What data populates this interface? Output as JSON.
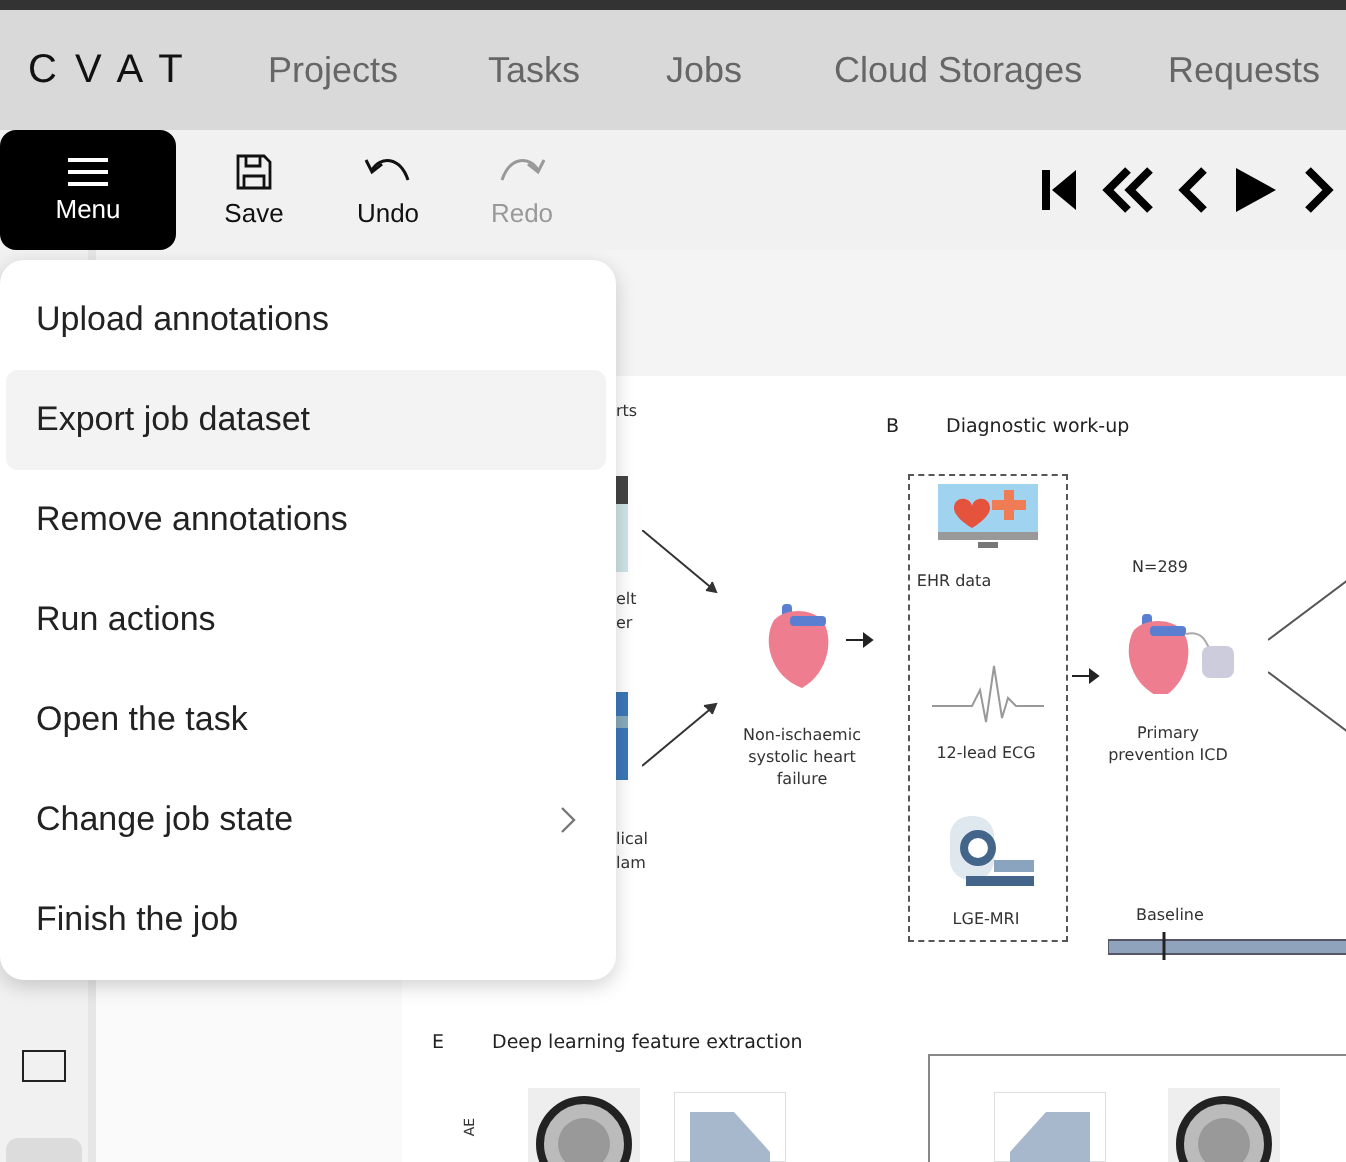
{
  "header": {
    "logo": "CVAT",
    "nav": [
      {
        "label": "Projects"
      },
      {
        "label": "Tasks"
      },
      {
        "label": "Jobs"
      },
      {
        "label": "Cloud Storages"
      },
      {
        "label": "Requests"
      }
    ]
  },
  "toolbar": {
    "menu_button": "Menu",
    "actions": [
      {
        "kind": "save",
        "label": "Save",
        "disabled": false
      },
      {
        "kind": "undo",
        "label": "Undo",
        "disabled": false
      },
      {
        "kind": "redo",
        "label": "Redo",
        "disabled": true
      }
    ],
    "player": [
      {
        "kind": "first"
      },
      {
        "kind": "fast-back"
      },
      {
        "kind": "back"
      },
      {
        "kind": "play"
      },
      {
        "kind": "forward"
      }
    ]
  },
  "menu": {
    "items": [
      {
        "label": "Upload annotations",
        "selected": false,
        "submenu": false
      },
      {
        "label": "Export job dataset",
        "selected": true,
        "submenu": false
      },
      {
        "label": "Remove annotations",
        "selected": false,
        "submenu": false
      },
      {
        "label": "Run actions",
        "selected": false,
        "submenu": false
      },
      {
        "label": "Open the task",
        "selected": false,
        "submenu": false
      },
      {
        "label": "Change job state",
        "selected": false,
        "submenu": true
      },
      {
        "label": "Finish the job",
        "selected": false,
        "submenu": false
      }
    ]
  },
  "figure": {
    "panel_a_fragments": [
      "rts",
      "elt",
      "er",
      "lical",
      "lam"
    ],
    "panel_b": {
      "letter": "B",
      "title": "Diagnostic work-up",
      "condition": "Non-ischaemic systolic heart failure",
      "inputs": [
        {
          "kind": "ehr",
          "label": "EHR data"
        },
        {
          "kind": "ecg",
          "label": "12-lead ECG"
        },
        {
          "kind": "mri",
          "label": "LGE-MRI"
        }
      ],
      "cohort_count": "N=289",
      "cohort_label": "Primary prevention ICD",
      "timeline_label": "Baseline"
    },
    "panel_e": {
      "letter": "E",
      "title": "Deep learning feature extraction",
      "side_label": "AE"
    }
  }
}
